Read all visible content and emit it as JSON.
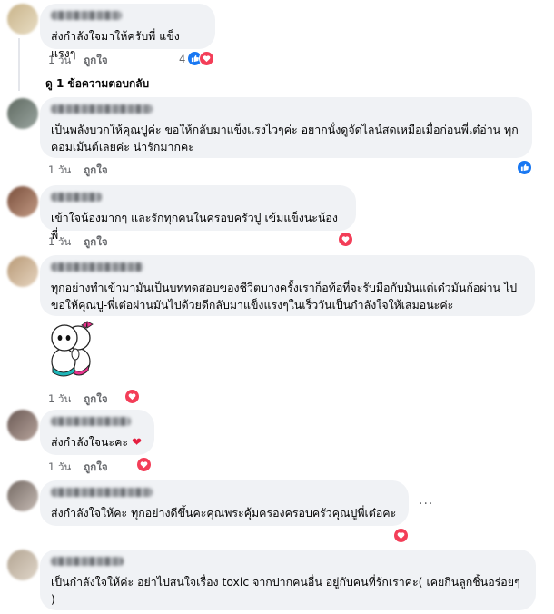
{
  "comments": [
    {
      "text": "ส่งกำลังใจมาให้ครับพี่ แข็งแรงๆ",
      "time": "1 วัน",
      "like": "ถูกใจ",
      "reaction_count": "4",
      "reactions": [
        "like-icon",
        "love-icon"
      ],
      "avatar_colors": [
        "#c9b48a",
        "#e8ddc4"
      ]
    },
    {
      "text": "เป็นพลังบวกให้คุณปูค่ะ ขอให้กลับมาแข็งแรงไวๆค่ะ อยากนั่งดูจัดไลน์สดเหมือเมื่อก่อนพี่เต๋อ่าน ทุกคอมเม้นต์เลยค่ะ น่ารักมากคะ",
      "time": "1 วัน",
      "like": "ถูกใจ",
      "reaction_count": "",
      "reactions": [
        "like-icon"
      ],
      "avatar_colors": [
        "#5f6a61",
        "#9aa5a0"
      ]
    },
    {
      "text": "เข้าใจน้องมากๆ และรักทุกคนในครอบครัวปู เข้มแข็งนะน้องพี่",
      "time": "1 วัน",
      "like": "ถูกใจ",
      "reaction_count": "",
      "reactions": [
        "love-icon"
      ],
      "avatar_colors": [
        "#7a4f3c",
        "#c29a84"
      ]
    },
    {
      "text": "ทุกอย่างทำเข้ามามันเป็นบททดสอบของชีวิตบางครั้งเราก็อท้อที่จะรับมือกับมันแต่เด๋วมันก้อผ่าน ไป ขอให้คุณปู-พี่เต๋อผ่านมันไปด้วยดีกลับมาแข็งแรงๆในเร็ววันเป็นกำลังใจให้เสมอนะค่ะ",
      "time": "1 วัน",
      "like": "ถูกใจ",
      "reaction_count": "",
      "reactions": [
        "love-icon"
      ],
      "avatar_colors": [
        "#b89a77",
        "#e6d4bf"
      ]
    },
    {
      "text": "ส่งกำลังใจนะคะ",
      "time": "1 วัน",
      "like": "ถูกใจ",
      "reaction_count": "",
      "reactions": [
        "love-icon"
      ],
      "avatar_colors": [
        "#6b5a55",
        "#b7a49c"
      ]
    },
    {
      "text": "ส่งกำลังใจให้คะ ทุกอย่างดีขึ้นคะคุณพระคุ้มครองครอบครัวคุณปูพี่เต๋อคะ",
      "time": "1 วัน",
      "like": "ถูกใจ",
      "reaction_count": "",
      "reactions": [
        "love-icon"
      ],
      "avatar_colors": [
        "#746963",
        "#c6bbb4"
      ]
    },
    {
      "text": "เป็นกำลังใจให้ค่ะ อย่าไปสนใจเรื่อง toxic จากปากคนอื่น อยู่กับคนที่รักเราค่ะ( เคยกินลูกชิ้นอร่อยๆ )",
      "time": "",
      "like": "",
      "reaction_count": "",
      "reactions": [],
      "avatar_colors": [
        "#b3a593",
        "#e0d6c9"
      ]
    }
  ],
  "replies_link": "ดู 1 ข้อความตอบกลับ",
  "more_options": "...",
  "colors": {
    "like": "#1877f2",
    "love": "#f33e58",
    "bubble": "#f0f2f5",
    "meta": "#65676b"
  }
}
